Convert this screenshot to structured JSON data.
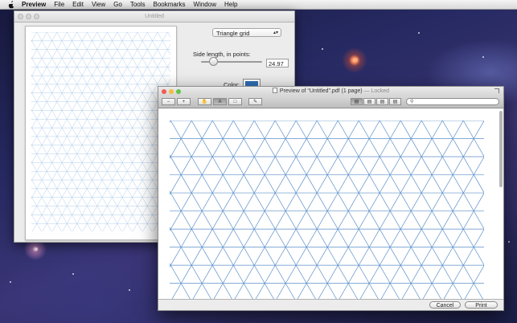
{
  "menubar": {
    "app": "Preview",
    "items": [
      "File",
      "Edit",
      "View",
      "Go",
      "Tools",
      "Bookmarks",
      "Window",
      "Help"
    ]
  },
  "back_window": {
    "title": "Untitled",
    "grid_type": "Triangle grid",
    "side_label": "Side length, in points:",
    "side_value": "24.97",
    "slider_fraction": 0.2,
    "color_label": "Color:",
    "color_value": "#2f6fb6"
  },
  "front_window": {
    "title": "Preview of “Untitled”.pdf (1 page)",
    "locked": "— Locked",
    "toolbar_icons": [
      "zoom-out-icon",
      "zoom-in-icon",
      "hand-tool-icon",
      "text-select-icon",
      "rect-select-icon",
      "annotate-icon"
    ],
    "view_icons": [
      "single-page-icon",
      "two-page-icon",
      "continuous-icon",
      "spread-icon"
    ],
    "cancel": "Cancel",
    "print": "Print"
  },
  "grid_color": "#5b8fc8"
}
